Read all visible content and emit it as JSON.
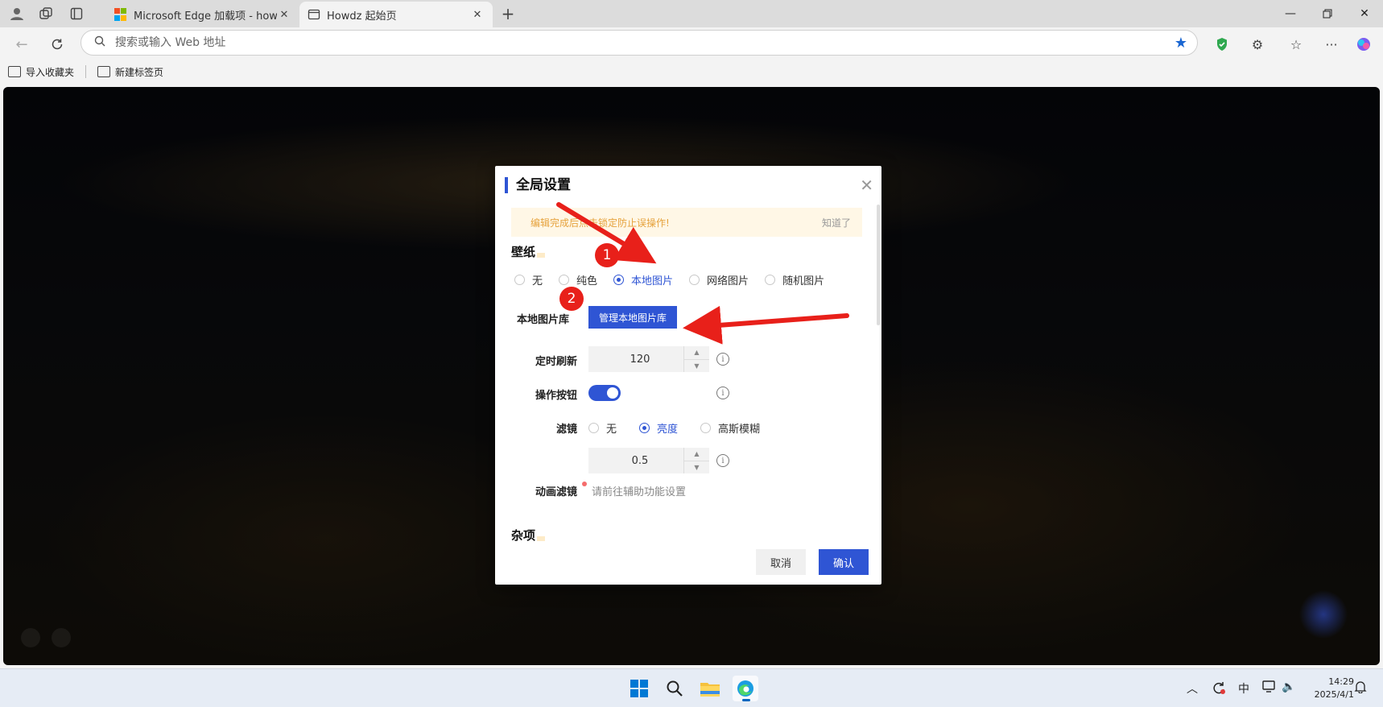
{
  "tabs": [
    {
      "title": "Microsoft Edge 加载项 - howdz起"
    },
    {
      "title": "Howdz 起始页"
    }
  ],
  "address": {
    "placeholder": "搜索或输入 Web 地址"
  },
  "bookmarks": [
    {
      "label": "导入收藏夹"
    },
    {
      "label": "新建标签页"
    }
  ],
  "dialog": {
    "title": "全局设置",
    "notice": {
      "message": "编辑完成后点击锁定防止误操作!",
      "dismiss": "知道了"
    },
    "wallpaper": {
      "heading": "壁纸",
      "options": [
        {
          "label": "无",
          "selected": false
        },
        {
          "label": "纯色",
          "selected": false
        },
        {
          "label": "本地图片",
          "selected": true
        },
        {
          "label": "网络图片",
          "selected": false
        },
        {
          "label": "随机图片",
          "selected": false
        }
      ],
      "library_label": "本地图片库",
      "library_button": "管理本地图片库",
      "refresh_label": "定时刷新",
      "refresh_value": "120",
      "action_label": "操作按钮",
      "action_enabled": true,
      "filter_label": "滤镜",
      "filter_options": [
        {
          "label": "无",
          "selected": false
        },
        {
          "label": "亮度",
          "selected": true
        },
        {
          "label": "高斯模糊",
          "selected": false
        }
      ],
      "filter_value": "0.5",
      "anim_label": "动画滤镜",
      "anim_hint": "请前往辅助功能设置"
    },
    "misc_heading": "杂项",
    "cancel": "取消",
    "confirm": "确认"
  },
  "annotations": {
    "step1": "1",
    "step2": "2",
    "arrow_color": "#e8201a"
  },
  "colors": {
    "accent": "#2f55d4",
    "notice_text": "#e6a23c"
  },
  "tray": {
    "input_method": "中"
  },
  "clock": {
    "time": "14:29",
    "date": "2025/4/1"
  }
}
